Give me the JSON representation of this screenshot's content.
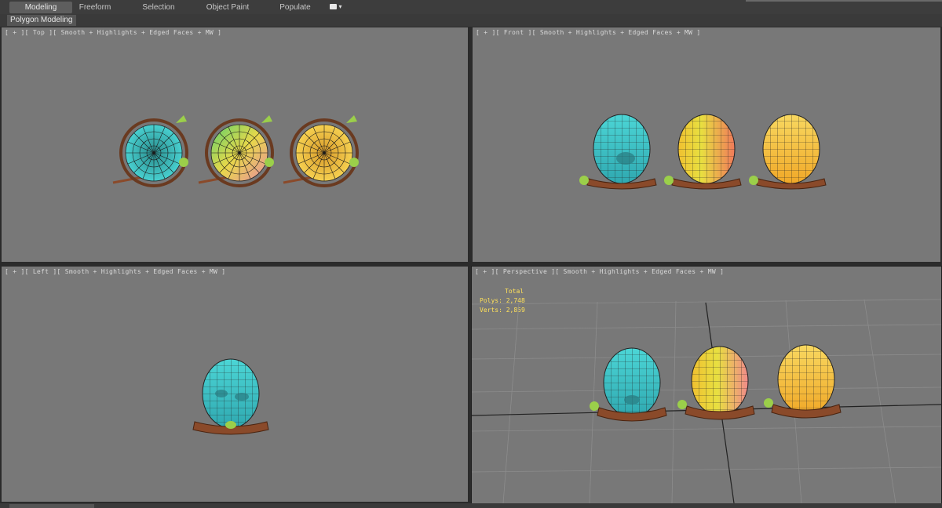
{
  "ribbon": {
    "tabs": [
      {
        "label": "Modeling",
        "active": true
      },
      {
        "label": "Freeform",
        "active": false
      },
      {
        "label": "Selection",
        "active": false
      },
      {
        "label": "Object Paint",
        "active": false
      },
      {
        "label": "Populate",
        "active": false
      }
    ],
    "extra_icon": "camera-dropdown-icon",
    "panel_label": "Polygon Modeling"
  },
  "viewports": {
    "top": {
      "label": "[ + ][ Top ][ Smooth + Highlights + Edged Faces + MW ]"
    },
    "front": {
      "label": "[ + ][ Front ][ Smooth + Highlights + Edged Faces + MW ]"
    },
    "left": {
      "label": "[ + ][ Left ][ Smooth + Highlights + Edged Faces + MW ]"
    },
    "perspective": {
      "label": "[ + ][ Perspective ][ Smooth + Highlights + Edged Faces + MW ]",
      "stats": {
        "header": "Total",
        "polys_label": "Polys:",
        "polys_value": "2,748",
        "verts_label": "Verts:",
        "verts_value": "2,859"
      }
    }
  },
  "colors": {
    "viewport_bg": "#787878",
    "egg_cyan": "#3ec6c6",
    "egg_multicolor": "#d4d84a",
    "egg_yellow": "#f2c23a",
    "nest_brown": "#8a4a2a",
    "leaf_green": "#9bcf4a",
    "stats_yellow": "#ffe15a"
  }
}
